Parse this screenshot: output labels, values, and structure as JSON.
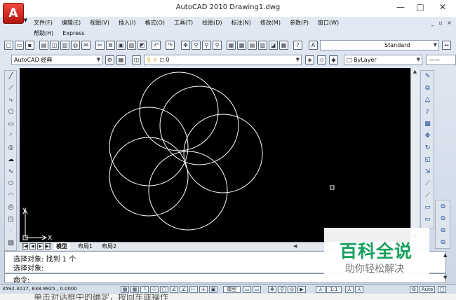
{
  "window": {
    "title": "AutoCAD 2010    Drawing1.dwg",
    "app_button": "A",
    "controls": [
      "—",
      "□",
      "✕"
    ]
  },
  "menu": {
    "items_row1": [
      "文件(F)",
      "编辑(E)",
      "视图(V)",
      "插入(I)",
      "格式(O)",
      "工具(T)",
      "绘图(D)",
      "标注(N)",
      "修改(M)",
      "参数(P)",
      "窗口(W)"
    ],
    "items_row2": [
      "帮助(H)",
      "Express"
    ],
    "mdi_controls": "_ ▫ ×"
  },
  "toolbar": {
    "text_style": "Standard",
    "workspace": "AutoCAD 经典",
    "layer": "0",
    "color": "ByLayer"
  },
  "layout_tabs": [
    "模型",
    "布局1",
    "布局2"
  ],
  "ucs": {
    "y_label": "Y",
    "x_label": "X"
  },
  "command": {
    "history": [
      "选择对象: 找到 1 个",
      "选择对象:"
    ],
    "prompt": "命令:"
  },
  "status": {
    "coords": "3592.3017, 838.9925 , 0.0000",
    "model_label": "模型",
    "scale": "1:1",
    "auto_label": "Auto"
  },
  "watermark": {
    "title": "百科全说",
    "subtitle": "助你轻松解决"
  },
  "footer_text": "单击对话框中的确定，按回车或操作",
  "colors": {
    "canvas": "#000000",
    "drawing_lines": "#ffffff",
    "app_red": "#d8261c",
    "watermark_green": "#16a05c"
  }
}
